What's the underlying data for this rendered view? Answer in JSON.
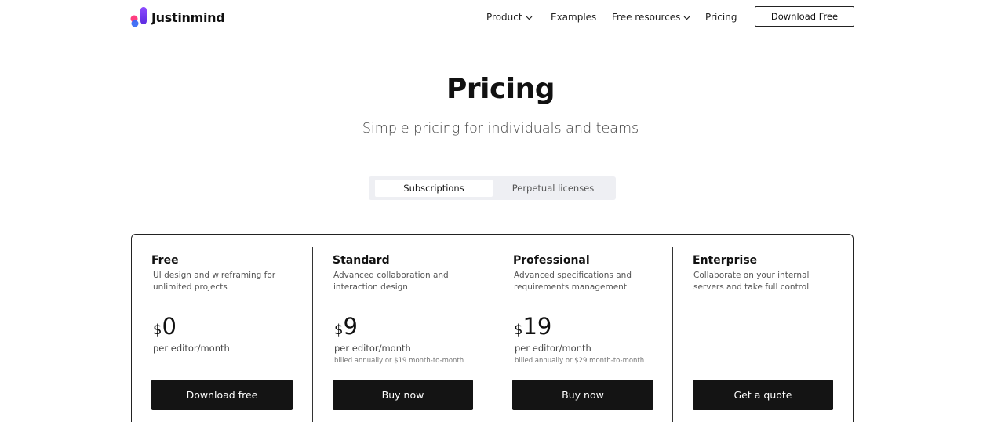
{
  "brand": {
    "name": "Justinmind"
  },
  "nav": {
    "items": [
      {
        "label": "Product",
        "dropdown": true
      },
      {
        "label": "Examples",
        "dropdown": false
      },
      {
        "label": "Free resources",
        "dropdown": true
      },
      {
        "label": "Pricing",
        "dropdown": false
      }
    ],
    "cta_label": "Download Free"
  },
  "hero": {
    "title": "Pricing",
    "subtitle": "Simple pricing for individuals and teams"
  },
  "toggle": {
    "options": [
      "Subscriptions",
      "Perpetual licenses"
    ],
    "selected": "Subscriptions"
  },
  "plans": [
    {
      "name": "Free",
      "description": "UI design and wireframing for unlimited projects",
      "currency": "$",
      "price": "0",
      "period": "per editor/month",
      "billing_note": "",
      "cta": "Download free"
    },
    {
      "name": "Standard",
      "description": "Advanced collaboration and interaction design",
      "currency": "$",
      "price": "9",
      "period": "per editor/month",
      "billing_note": "billed annually or $19 month-to-month",
      "cta": "Buy now"
    },
    {
      "name": "Professional",
      "description": "Advanced specifications and requirements management",
      "currency": "$",
      "price": "19",
      "period": "per editor/month",
      "billing_note": "billed annually or $29 month-to-month",
      "cta": "Buy now"
    },
    {
      "name": "Enterprise",
      "description": "Collaborate on your internal servers and take full control",
      "currency": "",
      "price": "",
      "period": "",
      "billing_note": "",
      "cta": "Get a quote"
    }
  ],
  "colors": {
    "text": "#111111",
    "cta_background": "#141414",
    "toggle_background": "#eeeff3",
    "logo_purple": "#7b3cf5",
    "logo_pink": "#ff3d7f",
    "logo_blue": "#3b6cf6"
  }
}
